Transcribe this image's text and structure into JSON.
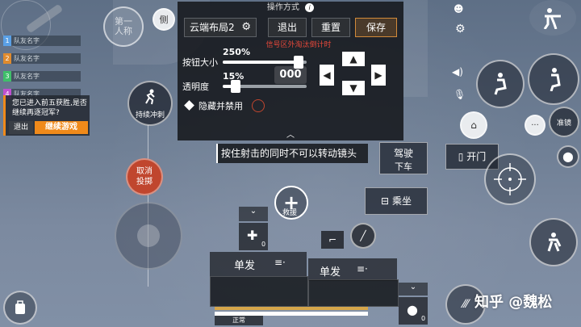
{
  "team": {
    "rows": [
      {
        "num": "1",
        "name": "队友名字",
        "color": "#5aa0e6"
      },
      {
        "num": "2",
        "name": "队友名字",
        "color": "#e08b2e"
      },
      {
        "num": "3",
        "name": "队友名字",
        "color": "#3fbf6a"
      },
      {
        "num": "4",
        "name": "队友名字",
        "color": "#c04fd0"
      }
    ]
  },
  "prompt": {
    "text": "您已进入前五获胜,是否继续再逐冠军?",
    "exit": "退出",
    "continue": "继续游戏"
  },
  "panel": {
    "title": "操作方式",
    "info_badge": "i",
    "layout_name": "云端布局2",
    "exit": "退出",
    "reset": "重置",
    "save": "保存",
    "warning": "信号区外淘汰倒计时",
    "size_label": "按钮大小",
    "size_value": "250%",
    "size_fraction": 0.9,
    "opacity_label": "透明度",
    "opacity_value": "15%",
    "opacity_fraction": 0.15,
    "hide_disable": "隐藏并禁用",
    "ammo_display": "000"
  },
  "hud": {
    "view_label": "第一人称",
    "side_icon_label": "侧",
    "sprint": "持续冲刺",
    "cancel_throw": "取消投掷",
    "tooltip": "按住射击的同时不可以转动镜头",
    "drive": "驾驶",
    "exit_vehicle": "下车",
    "open_door": "开门",
    "ride": "乘坐",
    "rescue": "救援",
    "single_fire_1": "单发",
    "single_fire_2": "单发",
    "aim": "准镜",
    "chat_label": "",
    "medkit_count": "0",
    "grenade_count": "0",
    "status": "正常",
    "watermark": "知乎 @魏松"
  },
  "colors": {
    "accent_orange": "#f08a1a",
    "save_bg": "#4a3a2a",
    "cancel_red": "#c0462e"
  }
}
